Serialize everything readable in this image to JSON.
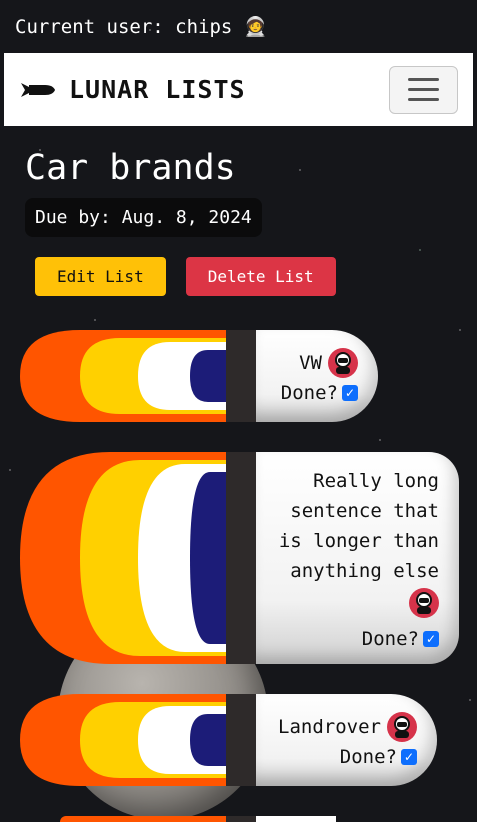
{
  "userbar": {
    "text": "Current user: chips 🧑‍🚀"
  },
  "navbar": {
    "brand": "LUNAR LISTS"
  },
  "list": {
    "title": "Car brands",
    "due": "Due by: Aug. 8, 2024",
    "edit_label": "Edit List",
    "delete_label": "Delete List"
  },
  "tasks": [
    {
      "text": "VW",
      "done_label": "Done?",
      "done": true
    },
    {
      "text": "Really long sentence that is longer than anything else",
      "done_label": "Done?",
      "done": true
    },
    {
      "text": "Landrover",
      "done_label": "Done?",
      "done": true
    }
  ],
  "colors": {
    "flame_outer": "#ff5500",
    "flame_mid": "#ffd000",
    "flame_inner": "#ffffff",
    "flame_core": "#1c1c78",
    "danger": "#dc3545",
    "warning": "#ffc107",
    "check": "#0d6efd"
  }
}
